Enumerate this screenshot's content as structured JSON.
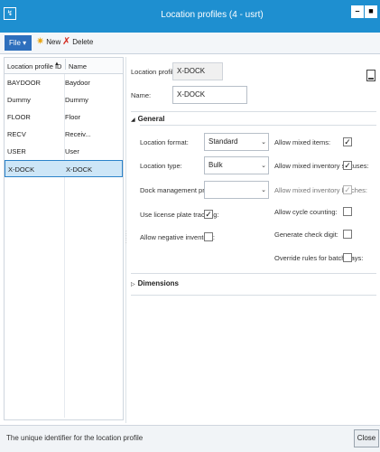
{
  "window": {
    "title": "Location profiles (4 - usrt)",
    "minimize": "–",
    "maximize": "■"
  },
  "actions": {
    "file_label": "File",
    "file_caret": "▾",
    "new_label": "New",
    "delete_label": "Delete"
  },
  "grid": {
    "headers": {
      "id": "Location profile ID",
      "name": "Name",
      "sort": "▲"
    },
    "rows": [
      {
        "id": "BAYDOOR",
        "name": "Baydoor",
        "selected": false
      },
      {
        "id": "Dummy",
        "name": "Dummy",
        "selected": false
      },
      {
        "id": "FLOOR",
        "name": "Floor",
        "selected": false
      },
      {
        "id": "RECV",
        "name": "Receiv...",
        "selected": false
      },
      {
        "id": "USER",
        "name": "User",
        "selected": false
      },
      {
        "id": "X-DOCK",
        "name": "X-DOCK",
        "selected": true
      }
    ]
  },
  "header_fields": {
    "profile_id_label": "Location profile ID:",
    "profile_id_value": "X-DOCK",
    "name_label": "Name:",
    "name_value": "X-DOCK"
  },
  "general": {
    "title": "General",
    "location_format_label": "Location format:",
    "location_format_value": "Standard",
    "location_type_label": "Location type:",
    "location_type_value": "Bulk",
    "dock_profile_label": "Dock management profile ID:",
    "dock_profile_value": "",
    "use_lp_label": "Use license plate tracking:",
    "use_lp_checked": true,
    "allow_neg_label": "Allow negative inventory:",
    "allow_neg_checked": false,
    "allow_mixed_items_label": "Allow mixed items:",
    "allow_mixed_items_checked": true,
    "allow_mixed_status_label": "Allow mixed inventory statuses:",
    "allow_mixed_status_checked": true,
    "allow_mixed_batches_label": "Allow mixed inventory batches:",
    "allow_mixed_batches_checked": true,
    "allow_cycle_label": "Allow cycle counting:",
    "allow_cycle_checked": false,
    "gen_check_label": "Generate check digit:",
    "gen_check_checked": false,
    "override_label": "Override rules for batch days:",
    "override_checked": false
  },
  "dimensions": {
    "title": "Dimensions"
  },
  "status": {
    "text": "The unique identifier for the location profile",
    "close_label": "Close"
  },
  "colors": {
    "titlebar": "#1e8fd0",
    "file_button": "#2e6fbd",
    "selection": "#cde6f7"
  }
}
